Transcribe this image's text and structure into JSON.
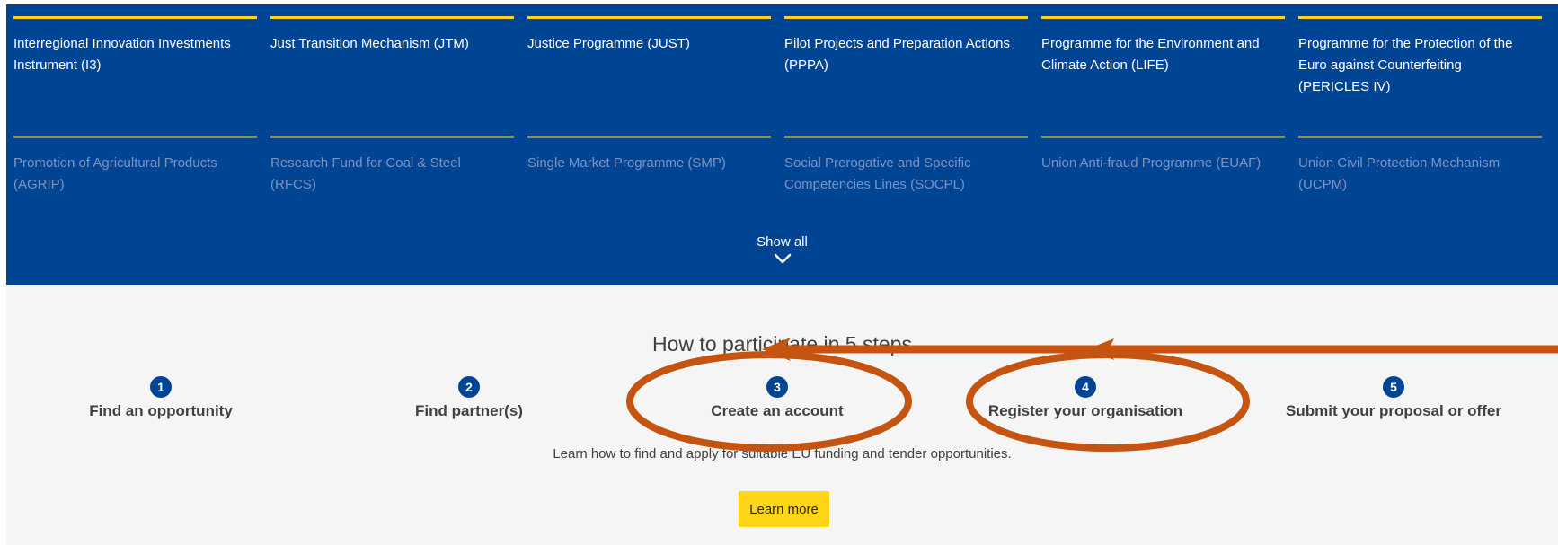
{
  "programmes": [
    {
      "label": "Interregional Innovation Investments Instrument (I3)"
    },
    {
      "label": "Just Transition Mechanism (JTM)"
    },
    {
      "label": "Justice Programme (JUST)"
    },
    {
      "label": "Pilot Projects and Preparation Actions (PPPA)"
    },
    {
      "label": "Programme for the Environment and Climate Action (LIFE)"
    },
    {
      "label": "Programme for the Protection of the Euro against Counterfeiting (PERICLES IV)"
    },
    {
      "label": "Promotion of Agricultural Products (AGRIP)"
    },
    {
      "label": "Research Fund for Coal & Steel (RFCS)"
    },
    {
      "label": "Single Market Programme (SMP)"
    },
    {
      "label": "Social Prerogative and Specific Competencies Lines (SOCPL)"
    },
    {
      "label": "Union Anti-fraud Programme (EUAF)"
    },
    {
      "label": "Union Civil Protection Mechanism (UCPM)"
    }
  ],
  "show_all": {
    "label": "Show all",
    "icon": "chevron-down-icon"
  },
  "steps_section": {
    "title": "How to participate in 5 steps",
    "steps": [
      {
        "number": "1",
        "label": "Find an opportunity"
      },
      {
        "number": "2",
        "label": "Find partner(s)"
      },
      {
        "number": "3",
        "label": "Create an account"
      },
      {
        "number": "4",
        "label": "Register your organisation"
      },
      {
        "number": "5",
        "label": "Submit your proposal or offer"
      }
    ],
    "description": "Learn how to find and apply for suitable EU funding and tender opportunities.",
    "learn_more_label": "Learn more"
  },
  "colors": {
    "primary_blue": "#004494",
    "accent_yellow": "#ffd617",
    "annotation_orange": "#c4540f",
    "section_bg": "#f5f5f5"
  }
}
